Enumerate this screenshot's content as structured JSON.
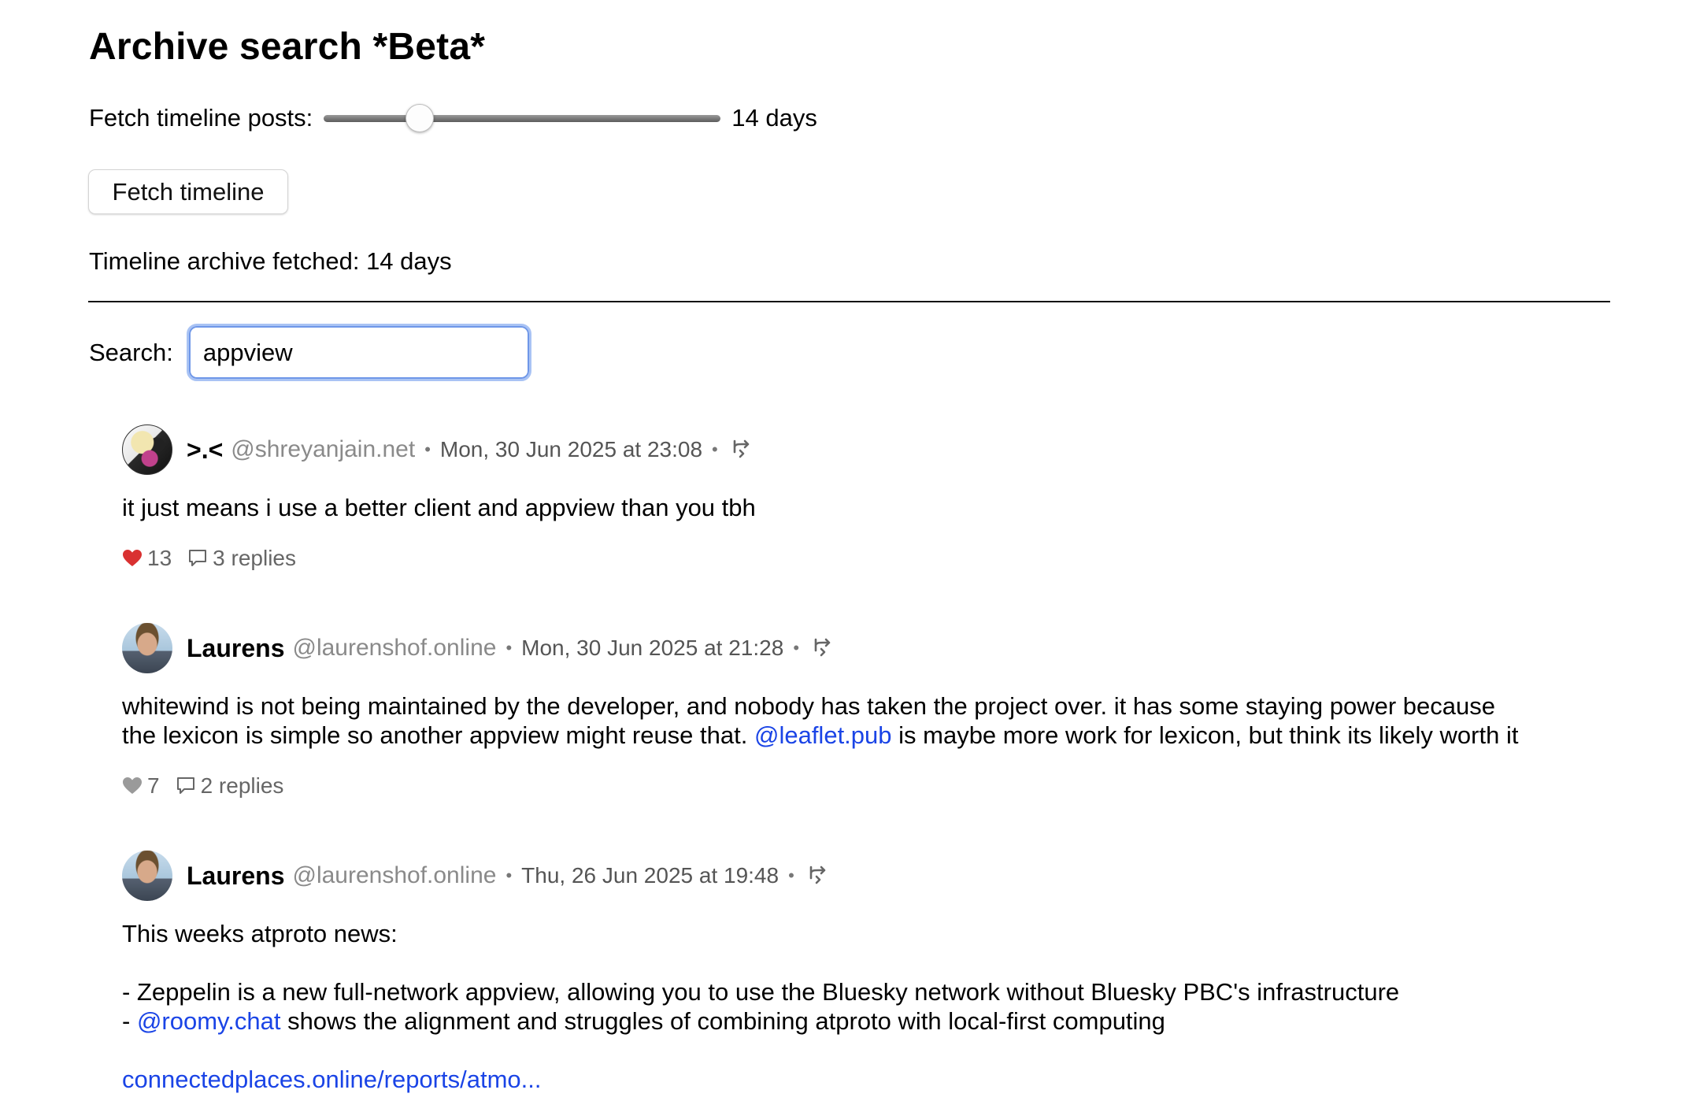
{
  "page": {
    "title": "Archive search *Beta*"
  },
  "fetch": {
    "label": "Fetch timeline posts:",
    "slider_fraction": 0.24,
    "value_label": "14 days",
    "button_label": "Fetch timeline",
    "status": "Timeline archive fetched: 14 days"
  },
  "search": {
    "label": "Search:",
    "value": "appview"
  },
  "colors": {
    "mention": "#1a44e6",
    "like_active": "#d93131",
    "like_inactive": "#9a9a9a",
    "focus_ring": "#a9c3f4"
  },
  "posts": [
    {
      "display_name": ">.<",
      "handle": "@shreyanjain.net",
      "separator": "•",
      "timestamp": "Mon, 30 Jun 2025 at 23:08",
      "body": "it just means i use a better client and appview than you tbh",
      "likes": "13",
      "liked": true,
      "replies": "3 replies"
    },
    {
      "display_name": "Laurens",
      "handle": "@laurenshof.online",
      "separator": "•",
      "timestamp": "Mon, 30 Jun 2025 at 21:28",
      "body_line1": "whitewind is not being maintained by the developer, and nobody has taken the project over. it has some staying power because",
      "body_line2_before": "the lexicon is simple so another appview might reuse that. ",
      "body_mention": "@leaflet.pub",
      "body_line2_after": " is maybe more work for lexicon, but think its likely worth it",
      "likes": "7",
      "liked": false,
      "replies": "2 replies"
    },
    {
      "display_name": "Laurens",
      "handle": "@laurenshof.online",
      "separator": "•",
      "timestamp": "Thu, 26 Jun 2025 at 19:48",
      "body_line1": "This weeks atproto news:",
      "body_line3": "- Zeppelin is a new full-network appview, allowing you to use the Bluesky network without Bluesky PBC's infrastructure",
      "body_line4_before": "- ",
      "body_mention": "@roomy.chat",
      "body_line4_after": " shows the alignment and struggles of combining atproto with local-first computing",
      "body_link": "connectedplaces.online/reports/atmo..."
    }
  ]
}
